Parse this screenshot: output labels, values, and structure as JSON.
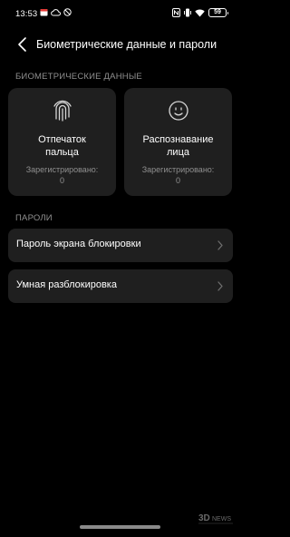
{
  "status_bar": {
    "time": "13:53",
    "left_icons": [
      "calendar-icon",
      "cloud-icon",
      "do-not-disturb-icon"
    ],
    "right_icons": [
      "nfc-icon",
      "vibrate-icon",
      "wifi-icon"
    ],
    "battery": "59"
  },
  "header": {
    "title": "Биометрические данные и пароли",
    "back_icon": "chevron-left-icon"
  },
  "biometrics": {
    "section_label": "БИОМЕТРИЧЕСКИЕ ДАННЫЕ",
    "tiles": [
      {
        "title_line1": "Отпечаток",
        "title_line2": "пальца",
        "status_line1": "Зарегистрировано:",
        "status_line2": "0",
        "icon": "fingerprint-icon"
      },
      {
        "title_line1": "Распознавание",
        "title_line2": "лица",
        "status_line1": "Зарегистрировано:",
        "status_line2": "0",
        "icon": "face-icon"
      }
    ]
  },
  "passwords": {
    "section_label": "ПАРОЛИ",
    "items": [
      {
        "label": "Пароль экрана блокировки"
      },
      {
        "label": "Умная разблокировка"
      }
    ]
  },
  "watermark": {
    "line1": "3D",
    "line2": "NEWS"
  },
  "colors": {
    "background": "#000000",
    "card": "#1f1f1f",
    "secondary_text": "#8f8f8f",
    "primary_text": "#ffffff"
  }
}
